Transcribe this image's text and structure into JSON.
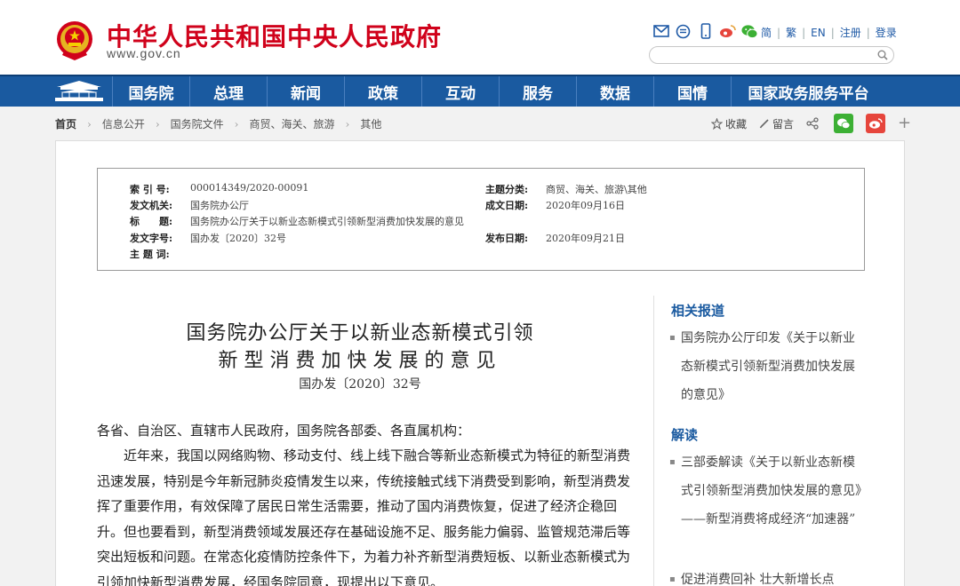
{
  "header": {
    "site_title": "中华人民共和国中央人民政府",
    "site_url": "www.gov.cn",
    "top_links": [
      "简",
      "繁",
      "EN",
      "注册",
      "登录"
    ],
    "icons": [
      "mail-icon",
      "message-icon",
      "mobile-icon",
      "weibo-icon",
      "wechat-icon"
    ],
    "search_placeholder": ""
  },
  "nav": {
    "items": [
      "国务院",
      "总理",
      "新闻",
      "政策",
      "互动",
      "服务",
      "数据",
      "国情",
      "国家政务服务平台"
    ]
  },
  "breadcrumb": [
    "首页",
    "信息公开",
    "国务院文件",
    "商贸、海关、旅游",
    "其他"
  ],
  "tools": {
    "favorite": "收藏",
    "comment": "留言"
  },
  "meta": {
    "index_label": "索 引 号:",
    "index_value": "000014349/2020-00091",
    "topic_label": "主题分类:",
    "topic_value": "商贸、海关、旅游\\其他",
    "issuer_label": "发文机关:",
    "issuer_value": "国务院办公厅",
    "date_written_label": "成文日期:",
    "date_written_value": "2020年09月16日",
    "title_label": "标　　题:",
    "title_value": "国务院办公厅关于以新业态新模式引领新型消费加快发展的意见",
    "doc_no_label": "发文字号:",
    "doc_no_value": "国办发〔2020〕32号",
    "publish_label": "发布日期:",
    "publish_value": "2020年09月21日",
    "keywords_label": "主 题 词:"
  },
  "article": {
    "title_line1": "国务院办公厅关于以新业态新模式引领",
    "title_line2": "新型消费加快发展的意见",
    "doc_number": "国办发〔2020〕32号",
    "salutation": "各省、自治区、直辖市人民政府，国务院各部委、各直属机构：",
    "paragraph1": "近年来，我国以网络购物、移动支付、线上线下融合等新业态新模式为特征的新型消费迅速发展，特别是今年新冠肺炎疫情发生以来，传统接触式线下消费受到影响，新型消费发挥了重要作用，有效保障了居民日常生活需要，推动了国内消费恢复，促进了经济企稳回升。但也要看到，新型消费领域发展还存在基础设施不足、服务能力偏弱、监管规范滞后等突出短板和问题。在常态化疫情防控条件下，为着力补齐新型消费短板、以新业态新模式为引领加快新型消费发展，经国务院同意，现提出以下意见。"
  },
  "sidebar": {
    "related_title": "相关报道",
    "related_items": [
      "国务院办公厅印发《关于以新业态新模式引领新型消费加快发展的意见》"
    ],
    "interpret_title": "解读",
    "interpret_items": [
      "三部委解读《关于以新业态新模式引领新型消费加快发展的意见》——新型消费将成经济“加速器”",
      "促进消费回补 壮大新增长点"
    ]
  },
  "colors": {
    "brand_red": "#d0021b",
    "nav_blue": "#1a5aa0",
    "wechat_green": "#3cb034",
    "weibo_red": "#e6453c"
  }
}
